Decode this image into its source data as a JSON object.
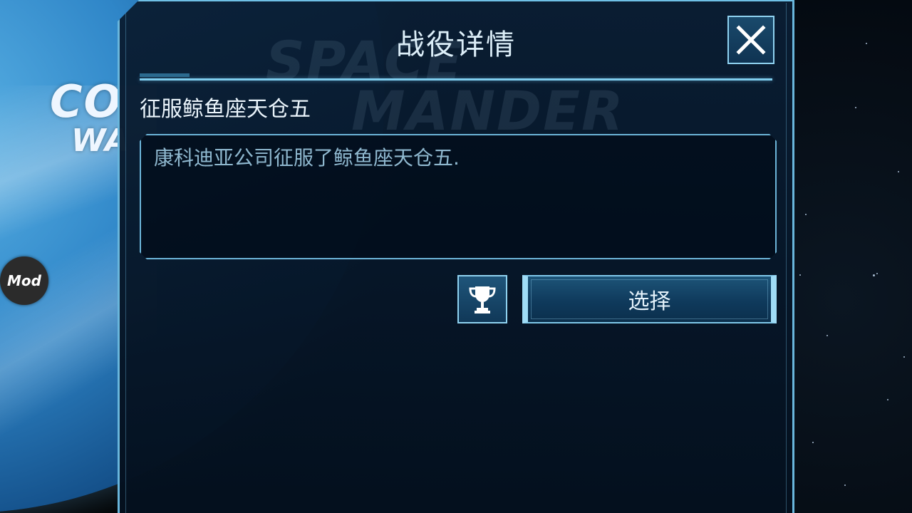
{
  "background": {
    "logo_line1": "SPACE",
    "logo_line2": "MANDER",
    "left_logo_line1": "CO",
    "left_logo_line2": "WA"
  },
  "mod_badge": {
    "label": "Mod"
  },
  "dialog": {
    "title": "战役详情",
    "subtitle": "征服鲸鱼座天仓五",
    "description": "康科迪亚公司征服了鲸鱼座天仓五.",
    "select_label": "选择",
    "close_icon": "close-icon",
    "trophy_icon": "trophy-icon"
  },
  "colors": {
    "accent": "#7fcdee",
    "panel_bg": "#0a1e34",
    "text_primary": "#eaf4fb",
    "text_secondary": "#8fb8cf"
  }
}
